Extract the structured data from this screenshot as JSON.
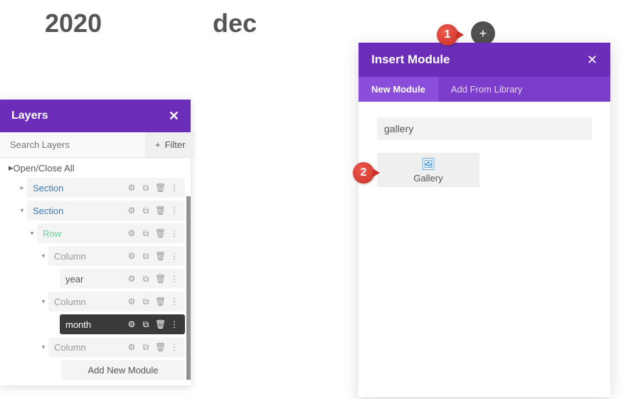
{
  "top": {
    "year": "2020",
    "month": "dec"
  },
  "layers": {
    "title": "Layers",
    "search_placeholder": "Search Layers",
    "filter_label": "Filter",
    "open_close_label": "Open/Close All",
    "add_module_label": "Add New Module",
    "items": [
      {
        "label": "Section",
        "kind": "section",
        "caret": "right"
      },
      {
        "label": "Section",
        "kind": "section",
        "caret": "down"
      },
      {
        "label": "Row",
        "kind": "row",
        "caret": "down"
      },
      {
        "label": "Column",
        "kind": "column",
        "caret": "down"
      },
      {
        "label": "year",
        "kind": "module"
      },
      {
        "label": "Column",
        "kind": "column",
        "caret": "down"
      },
      {
        "label": "month",
        "kind": "module",
        "active": true
      },
      {
        "label": "Column",
        "kind": "column",
        "caret": "down"
      }
    ]
  },
  "badges": {
    "one": "1",
    "two": "2"
  },
  "plus": "+",
  "insert": {
    "title": "Insert Module",
    "tabs": {
      "new": "New Module",
      "library": "Add From Library"
    },
    "search_value": "gallery",
    "module": {
      "name": "Gallery",
      "icon": "🖼"
    }
  }
}
